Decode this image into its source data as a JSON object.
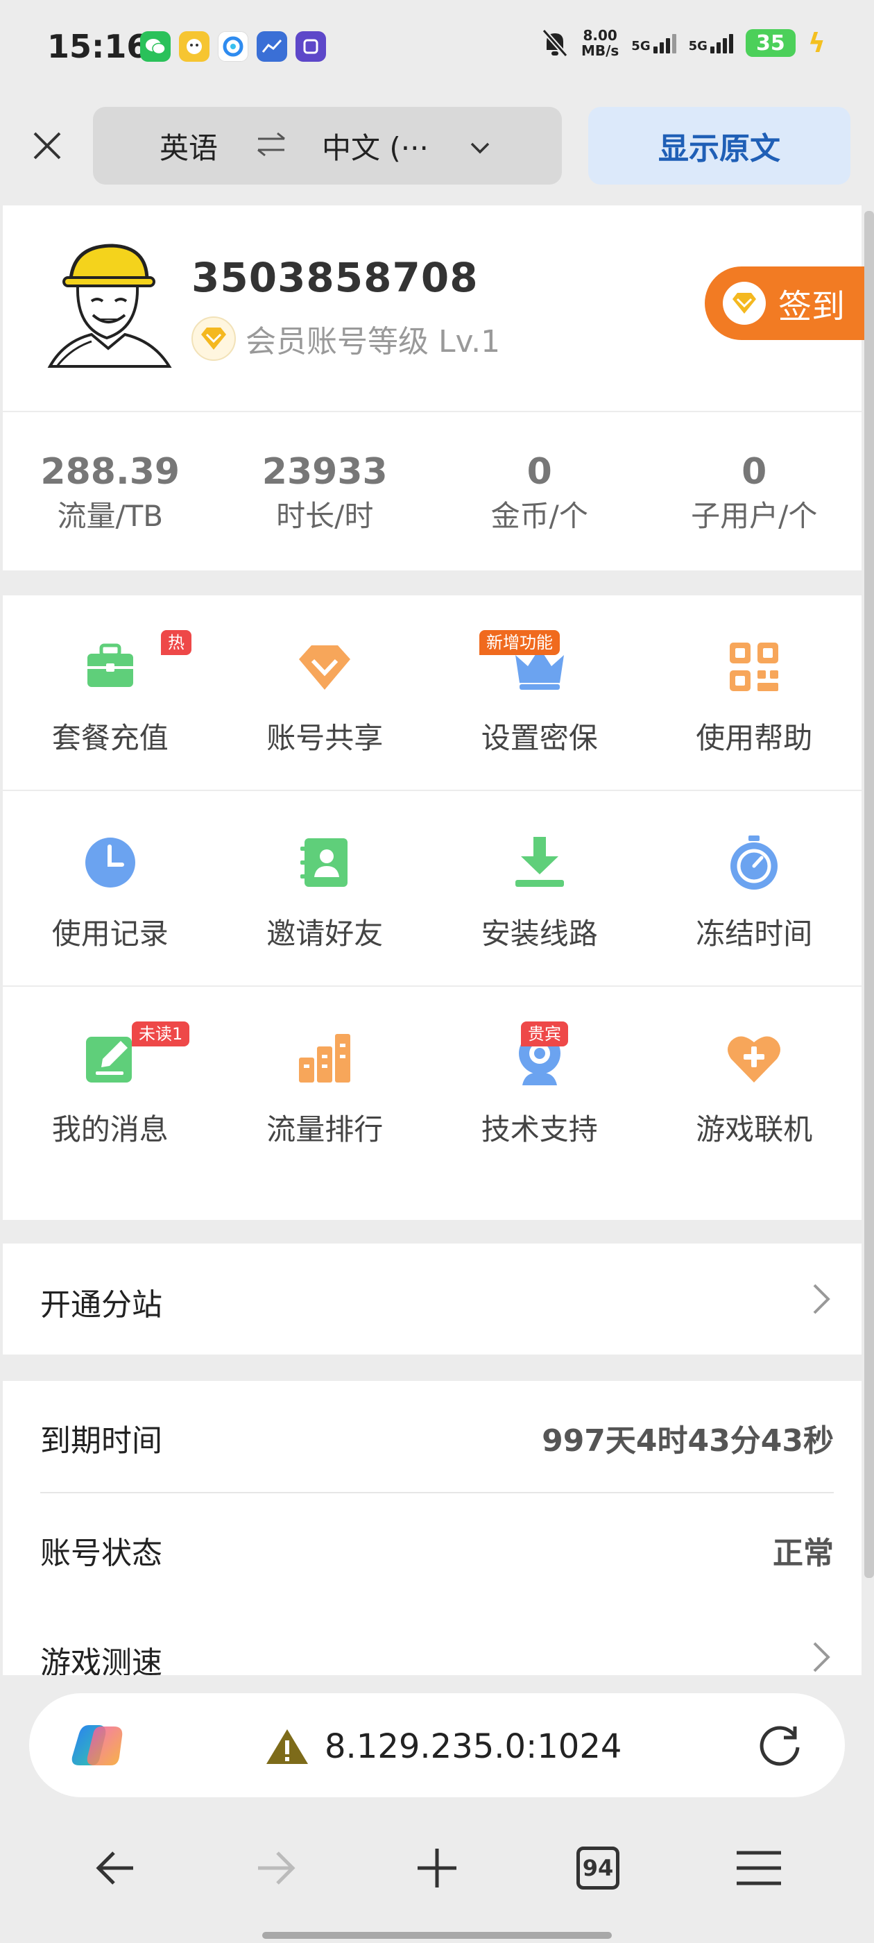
{
  "status_bar": {
    "time": "15:16",
    "speed_value": "8.00",
    "speed_unit": "MB/s",
    "net1": "5G",
    "net2": "5G",
    "battery": "35",
    "apps": [
      {
        "icon": "wechat-icon",
        "color": "#2ac15a",
        "glyph": "W"
      },
      {
        "icon": "app-yellow-icon",
        "color": "#f6c531",
        "glyph": "B"
      },
      {
        "icon": "browser-icon",
        "color": "#2e8bef",
        "glyph": "Q"
      },
      {
        "icon": "chart-app-icon",
        "color": "#3a6fd6",
        "glyph": "~"
      },
      {
        "icon": "tieba-icon",
        "color": "#5d47c9",
        "glyph": "T"
      }
    ]
  },
  "translate_bar": {
    "source_lang": "英语",
    "target_lang": "中文 (···",
    "show_original": "显示原文"
  },
  "profile": {
    "username": "3503858708",
    "level_text": "会员账号等级 Lv.1",
    "signin_label": "签到"
  },
  "stats": [
    {
      "value": "288.39",
      "label": "流量/TB"
    },
    {
      "value": "23933",
      "label": "时长/时"
    },
    {
      "value": "0",
      "label": "金币/个"
    },
    {
      "value": "0",
      "label": "子用户/个"
    }
  ],
  "grid": {
    "row1": [
      {
        "label": "套餐充值",
        "icon": "briefcase-icon",
        "badge": "热"
      },
      {
        "label": "账号共享",
        "icon": "diamond-icon",
        "badge": ""
      },
      {
        "label": "设置密保",
        "icon": "crown-icon",
        "badge": "新增功能"
      },
      {
        "label": "使用帮助",
        "icon": "grid-apps-icon",
        "badge": ""
      }
    ],
    "row2": [
      {
        "label": "使用记录",
        "icon": "clock-icon",
        "badge": ""
      },
      {
        "label": "邀请好友",
        "icon": "contact-book-icon",
        "badge": ""
      },
      {
        "label": "安装线路",
        "icon": "download-icon",
        "badge": ""
      },
      {
        "label": "冻结时间",
        "icon": "stopwatch-icon",
        "badge": ""
      }
    ],
    "row3": [
      {
        "label": "我的消息",
        "icon": "edit-message-icon",
        "badge": "未读1"
      },
      {
        "label": "流量排行",
        "icon": "ranking-buildings-icon",
        "badge": ""
      },
      {
        "label": "技术支持",
        "icon": "webcam-icon",
        "badge": "贵宾"
      },
      {
        "label": "游戏联机",
        "icon": "heart-plus-icon",
        "badge": ""
      }
    ]
  },
  "branch": {
    "label": "开通分站"
  },
  "info": {
    "expire_label": "到期时间",
    "expire_value": "997天4时43分43秒",
    "status_label": "账号状态",
    "status_value": "正常",
    "speedtest_label": "游戏测速"
  },
  "browser": {
    "url": "8.129.235.0:1024",
    "tabs_count": "94"
  },
  "colors": {
    "accent_orange": "#f27b23",
    "badge_red": "#ee4848",
    "link_blue": "#1f5fb6",
    "icon_green": "#5fcf7a",
    "icon_orange": "#f7a65a",
    "icon_blue": "#6ba3f0"
  }
}
